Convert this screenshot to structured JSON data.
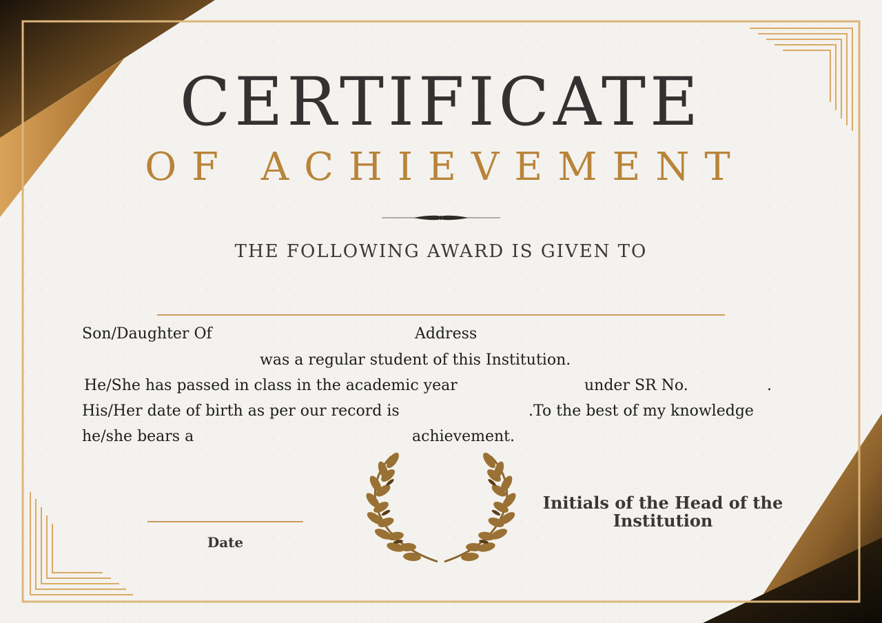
{
  "certificate": {
    "title": "CERTIFICATE",
    "subtitle": "OF ACHIEVEMENT",
    "given_to": "THE FOLLOWING AWARD IS GIVEN TO",
    "line1_left": "Son/Daughter Of",
    "line1_right": "Address",
    "line2": "was a regular student of this Institution.",
    "line3_a": "He/She has passed in class  in the academic year",
    "line3_b": "under SR No.",
    "line3_c": ".",
    "line4_a": "His/Her date of birth as per our record is",
    "line4_b": ".To the best of my knowledge",
    "line5_a": "he/she bears a",
    "line5_b": "achievement.",
    "date_label": "Date",
    "initials_label": "Initials of the Head of the Institution"
  },
  "colors": {
    "gold": "#b8843a",
    "dark_gold": "#5a3e16",
    "text_dark": "#333131",
    "background": "#f4f2ee"
  },
  "icons": [
    "laurel-wreath-icon",
    "ornament-divider-icon"
  ]
}
